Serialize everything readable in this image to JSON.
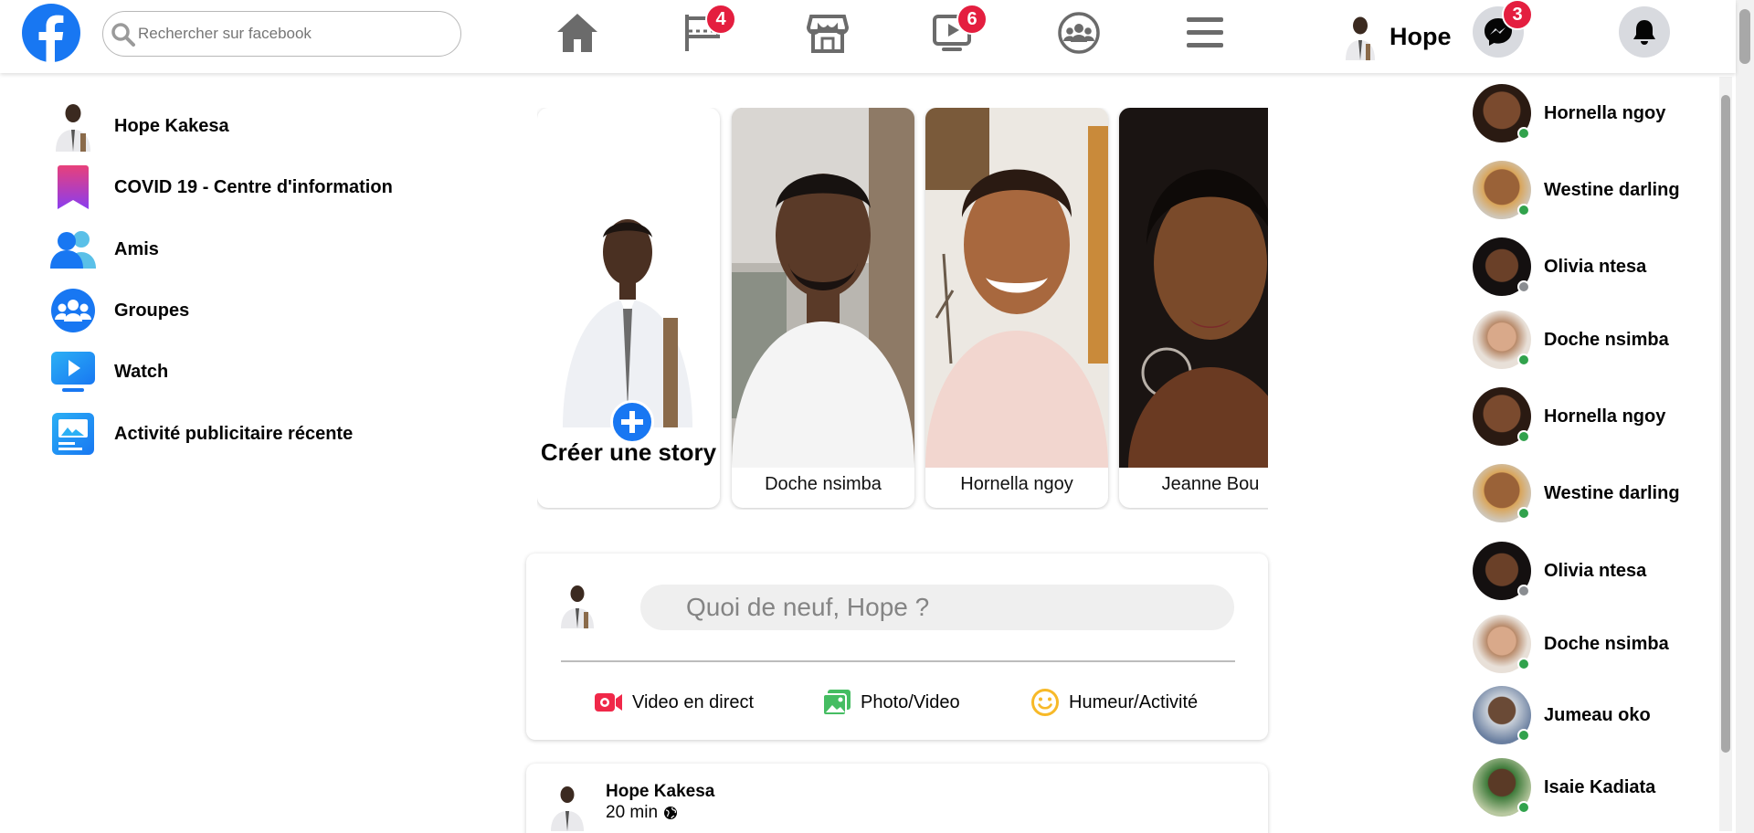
{
  "header": {
    "search_placeholder": "Rechercher sur facebook",
    "nav": [
      {
        "name": "home",
        "badge": ""
      },
      {
        "name": "pages",
        "badge": "4"
      },
      {
        "name": "marketplace",
        "badge": ""
      },
      {
        "name": "watch",
        "badge": "6"
      },
      {
        "name": "groups",
        "badge": ""
      },
      {
        "name": "menu",
        "badge": ""
      }
    ],
    "profile_name": "Hope",
    "messenger_badge": "3",
    "colors": {
      "brand": "#1877f2",
      "badge": "#e41e3f",
      "online": "#31a24c",
      "offline": "#8a8d91"
    }
  },
  "sidebar": {
    "items": [
      {
        "label": "Hope Kakesa",
        "icon": "profile-avatar"
      },
      {
        "label": "COVID 19 - Centre d'information",
        "icon": "covid-bookmark-icon"
      },
      {
        "label": "Amis",
        "icon": "friends-icon"
      },
      {
        "label": "Groupes",
        "icon": "groups-icon"
      },
      {
        "label": "Watch",
        "icon": "watch-icon"
      },
      {
        "label": "Activité publicitaire récente",
        "icon": "ad-activity-icon"
      }
    ]
  },
  "stories": {
    "create_label": "Créer une story",
    "items": [
      {
        "name": "Doche nsimba"
      },
      {
        "name": "Hornella ngoy"
      },
      {
        "name": "Jeanne Bou"
      }
    ]
  },
  "composer": {
    "placeholder": "Quoi de neuf, Hope ?",
    "actions": [
      {
        "label": "Video en direct",
        "icon": "live-video-icon"
      },
      {
        "label": "Photo/Video",
        "icon": "photo-icon"
      },
      {
        "label": "Humeur/Activité",
        "icon": "smiley-icon"
      }
    ]
  },
  "post": {
    "author": "Hope Kakesa",
    "time": "20 min"
  },
  "contacts": [
    {
      "name": "Hornella ngoy",
      "online": true
    },
    {
      "name": "Westine darling",
      "online": true
    },
    {
      "name": "Olivia ntesa",
      "online": false
    },
    {
      "name": "Doche nsimba",
      "online": true
    },
    {
      "name": "Hornella ngoy",
      "online": true
    },
    {
      "name": "Westine darling",
      "online": true
    },
    {
      "name": "Olivia ntesa",
      "online": false
    },
    {
      "name": "Doche nsimba",
      "online": true
    },
    {
      "name": "Jumeau oko",
      "online": true
    },
    {
      "name": "Isaie Kadiata",
      "online": true
    }
  ]
}
